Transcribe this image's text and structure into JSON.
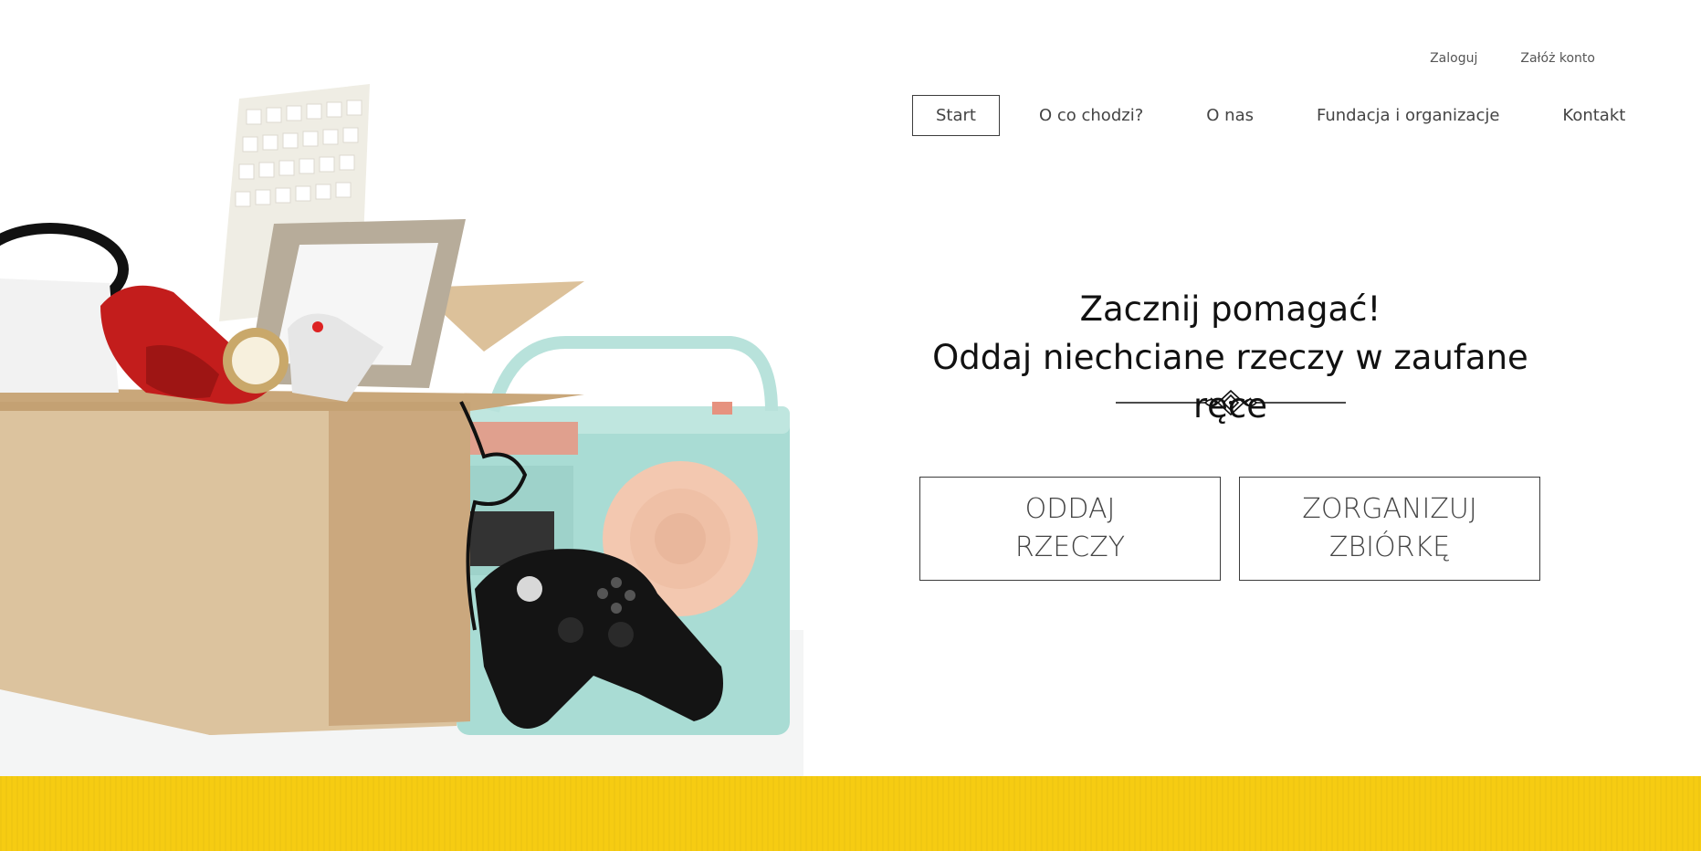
{
  "auth": {
    "login_label": "Zaloguj",
    "register_label": "Załóż konto"
  },
  "nav": {
    "items": [
      {
        "label": "Start",
        "active": true
      },
      {
        "label": "O co chodzi?"
      },
      {
        "label": "O nas"
      },
      {
        "label": "Fundacja i organizacje"
      },
      {
        "label": "Kontakt"
      }
    ]
  },
  "hero": {
    "title_line1": "Zacznij pomagać!",
    "title_line2": "Oddaj niechciane rzeczy w zaufane ręce",
    "divider_icon": "ornamental-divider-icon",
    "illustration": "box-of-unwanted-items-illustration"
  },
  "cta": {
    "give_line1": "ODDAJ",
    "give_line2": "RZECZY",
    "organize_line1": "ZORGANIZUJ",
    "organize_line2": "ZBIÓRKĘ"
  },
  "colors": {
    "accent_yellow": "#f6cc12",
    "border_dark": "#3c3c3c"
  }
}
